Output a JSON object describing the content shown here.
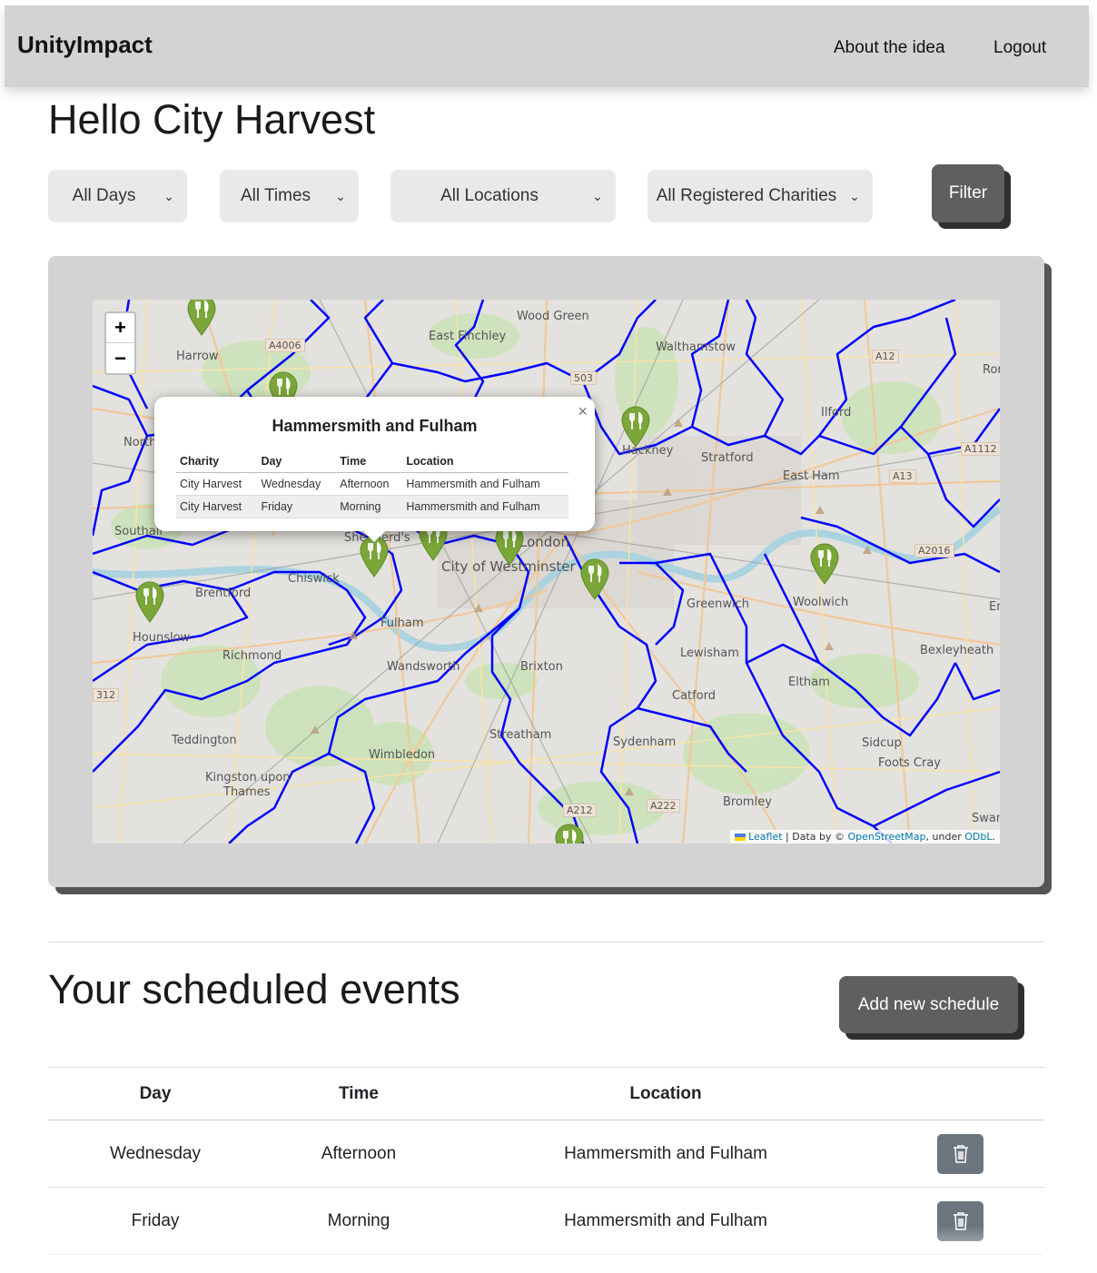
{
  "navbar": {
    "brand": "UnityImpact",
    "about": "About the idea",
    "logout": "Logout"
  },
  "greeting": "Hello City Harvest",
  "filters": {
    "days": "All Days",
    "times": "All Times",
    "locations": "All Locations",
    "charities": "All Registered Charities",
    "filter_button": "Filter"
  },
  "map": {
    "zoom_in": "+",
    "zoom_out": "−",
    "labels": {
      "wood_green": "Wood Green",
      "east_finchley": "East Finchley",
      "walthamstow": "Walthamstow",
      "harrow": "Harrow",
      "ilford": "Ilford",
      "hackney": "Hackney",
      "stratford": "Stratford",
      "east_ham": "East Ham",
      "north": "North",
      "southall": "Southall",
      "shepherds_bush": "Shepherd's",
      "london": "London",
      "city_of_westminster": "City of Westminster",
      "chiswick": "Chiswick",
      "brentford": "Brentford",
      "fulham": "Fulham",
      "greenwich": "Greenwich",
      "woolwich": "Woolwich",
      "hounslow": "Hounslow",
      "richmond": "Richmond",
      "lewisham": "Lewisham",
      "bexleyheath": "Bexleyheath",
      "wandsworth": "Wandsworth",
      "brixton": "Brixton",
      "eltham": "Eltham",
      "catford": "Catford",
      "teddington": "Teddington",
      "streatham": "Streatham",
      "sydenham": "Sydenham",
      "sidcup": "Sidcup",
      "wimbledon": "Wimbledon",
      "foots_cray": "Foots Cray",
      "kingston": "Kingston upon",
      "thames": "Thames",
      "bromley": "Bromley",
      "swanley": "Swanl",
      "romford": "Ror",
      "er": "Er"
    },
    "roads": {
      "a4006": "A4006",
      "a503": "503",
      "a12": "A12",
      "a1112": "A1112",
      "a13": "A13",
      "a2016": "A2016",
      "a212": "A212",
      "a222": "A222",
      "a312": "312"
    },
    "popup": {
      "close": "×",
      "title": "Hammersmith and Fulham",
      "headers": [
        "Charity",
        "Day",
        "Time",
        "Location"
      ],
      "rows": [
        [
          "City Harvest",
          "Wednesday",
          "Afternoon",
          "Hammersmith and Fulham"
        ],
        [
          "City Harvest",
          "Friday",
          "Morning",
          "Hammersmith and Fulham"
        ]
      ]
    },
    "attribution": {
      "leaflet": "Leaflet",
      "sep": " | Data by © ",
      "osm": "OpenStreetMap",
      "under": ", under ",
      "odbl": "ODbL",
      "end": "."
    },
    "marker_icon": "fork-knife-icon",
    "marker_color": "#7ba63a",
    "boundary_color": "#0000ff"
  },
  "events": {
    "title": "Your scheduled events",
    "add_button": "Add new schedule",
    "headers": [
      "Day",
      "Time",
      "Location",
      ""
    ],
    "rows": [
      {
        "day": "Wednesday",
        "time": "Afternoon",
        "location": "Hammersmith and Fulham"
      },
      {
        "day": "Friday",
        "time": "Morning",
        "location": "Hammersmith and Fulham"
      }
    ],
    "delete_icon": "trash-icon"
  }
}
